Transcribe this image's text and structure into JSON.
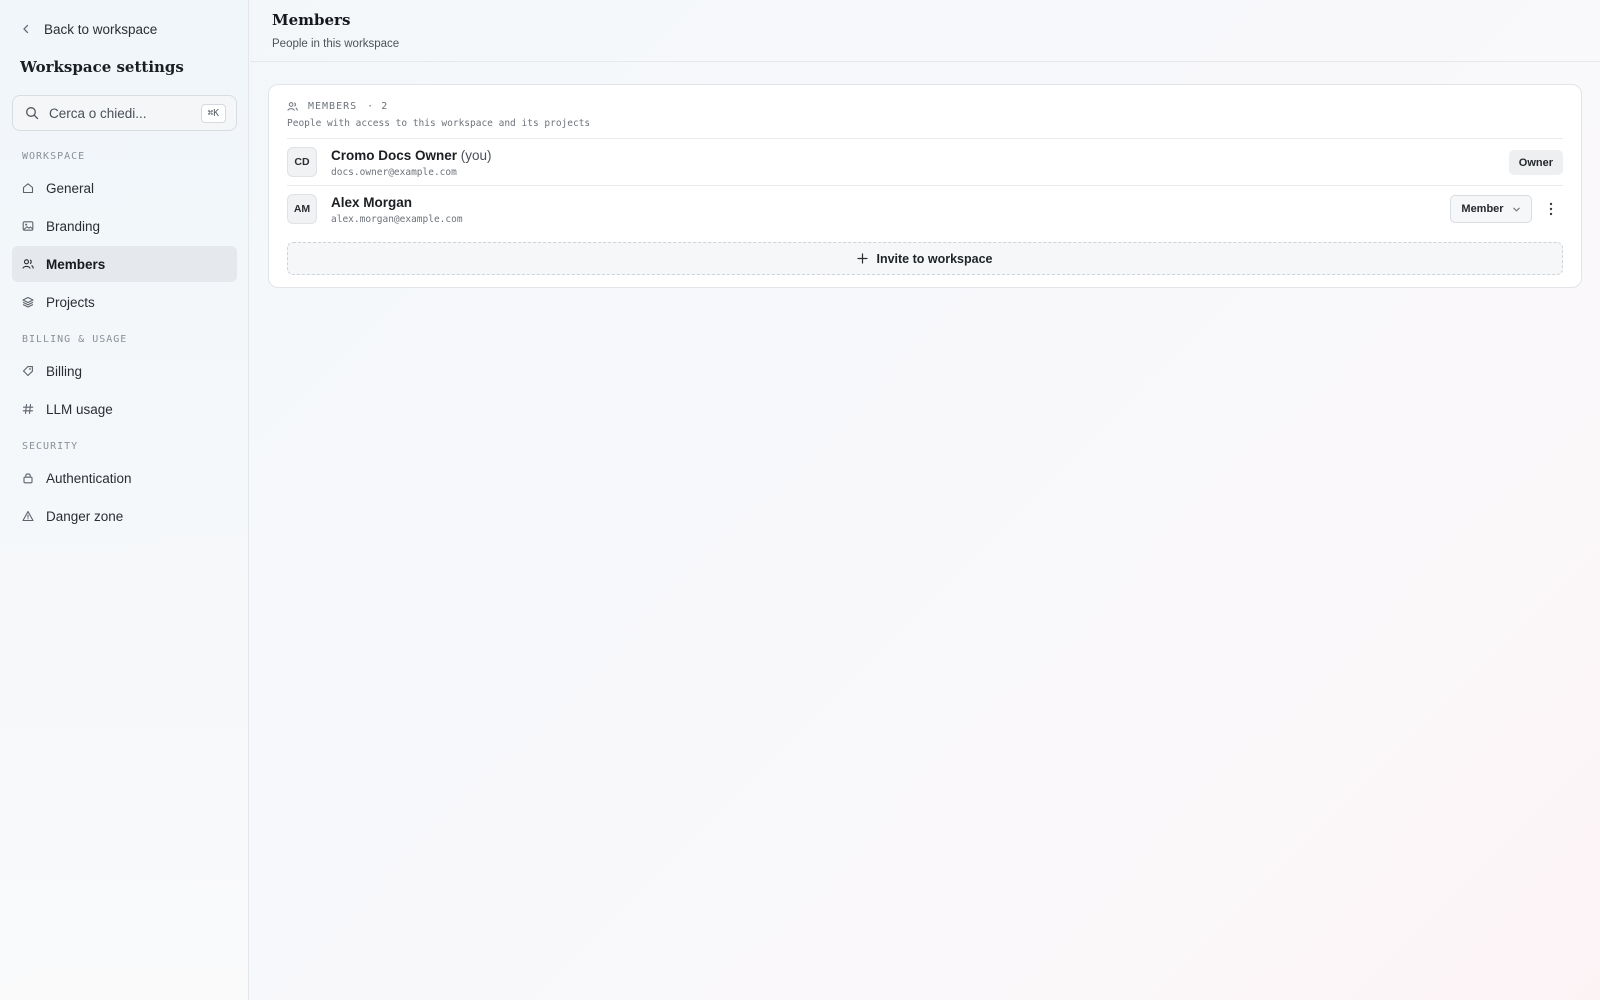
{
  "sidebar": {
    "back_label": "Back to workspace",
    "title": "Workspace settings",
    "search": {
      "placeholder": "Cerca o chiedi...",
      "shortcut": "⌘K"
    },
    "sections": {
      "workspace": "WORKSPACE",
      "billing": "BILLING & USAGE",
      "security": "SECURITY"
    },
    "items": {
      "general": "General",
      "branding": "Branding",
      "members": "Members",
      "projects": "Projects",
      "billing": "Billing",
      "llm_usage": "LLM usage",
      "authentication": "Authentication",
      "danger_zone": "Danger zone"
    },
    "active_item": "Members"
  },
  "header": {
    "title": "Members",
    "subtitle": "People in this workspace"
  },
  "members_card": {
    "label": "MEMBERS",
    "count": "· 2",
    "description": "People with access to this workspace and its projects",
    "members": [
      {
        "initials": "CD",
        "name": "Cromo Docs Owner",
        "suffix": "(you)",
        "email": "docs.owner@example.com",
        "role": "Owner"
      },
      {
        "initials": "AM",
        "name": "Alex Morgan",
        "suffix": "",
        "email": "alex.morgan@example.com",
        "role": "Member"
      }
    ],
    "invite_label": "Invite to workspace"
  },
  "icons": {
    "back": "chevron-left-icon",
    "search": "search-icon",
    "general": "home-icon",
    "branding": "image-icon",
    "members": "users-icon",
    "projects": "layers-icon",
    "billing": "tag-icon",
    "llm_usage": "hash-icon",
    "authentication": "lock-icon",
    "danger_zone": "warning-triangle-icon",
    "role_dropdown": "chevron-down-icon",
    "more": "more-vertical-icon",
    "invite": "plus-icon"
  }
}
